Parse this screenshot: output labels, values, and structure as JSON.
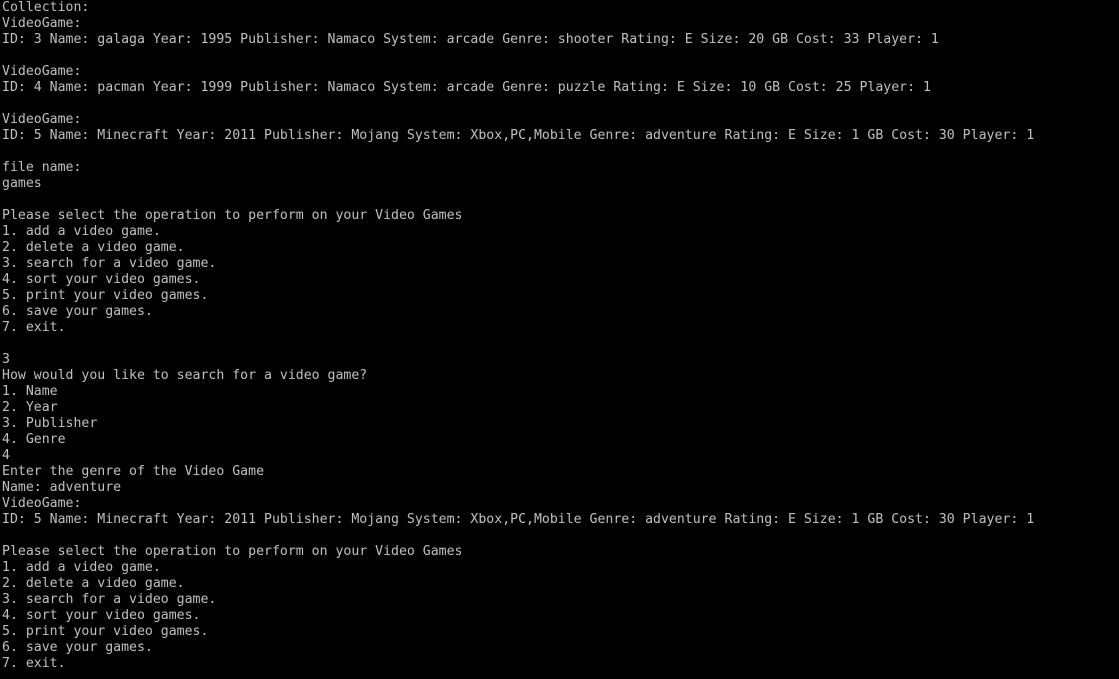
{
  "terminal": {
    "colors": {
      "background": "#000000",
      "foreground": "#c0c0c0"
    },
    "lines": [
      "Collection:",
      "VideoGame:",
      "ID: 3 Name: galaga Year: 1995 Publisher: Namaco System: arcade Genre: shooter Rating: E Size: 20 GB Cost: 33 Player: 1",
      "",
      "VideoGame:",
      "ID: 4 Name: pacman Year: 1999 Publisher: Namaco System: arcade Genre: puzzle Rating: E Size: 10 GB Cost: 25 Player: 1",
      "",
      "VideoGame:",
      "ID: 5 Name: Minecraft Year: 2011 Publisher: Mojang System: Xbox,PC,Mobile Genre: adventure Rating: E Size: 1 GB Cost: 30 Player: 1",
      "",
      "file name:",
      "games",
      "",
      "Please select the operation to perform on your Video Games",
      "1. add a video game.",
      "2. delete a video game.",
      "3. search for a video game.",
      "4. sort your video games.",
      "5. print your video games.",
      "6. save your games.",
      "7. exit.",
      "",
      "3",
      "How would you like to search for a video game?",
      "1. Name",
      "2. Year",
      "3. Publisher",
      "4. Genre",
      "4",
      "Enter the genre of the Video Game",
      "Name: adventure",
      "VideoGame:",
      "ID: 5 Name: Minecraft Year: 2011 Publisher: Mojang System: Xbox,PC,Mobile Genre: adventure Rating: E Size: 1 GB Cost: 30 Player: 1",
      "",
      "Please select the operation to perform on your Video Games",
      "1. add a video game.",
      "2. delete a video game.",
      "3. search for a video game.",
      "4. sort your video games.",
      "5. print your video games.",
      "6. save your games.",
      "7. exit."
    ]
  }
}
